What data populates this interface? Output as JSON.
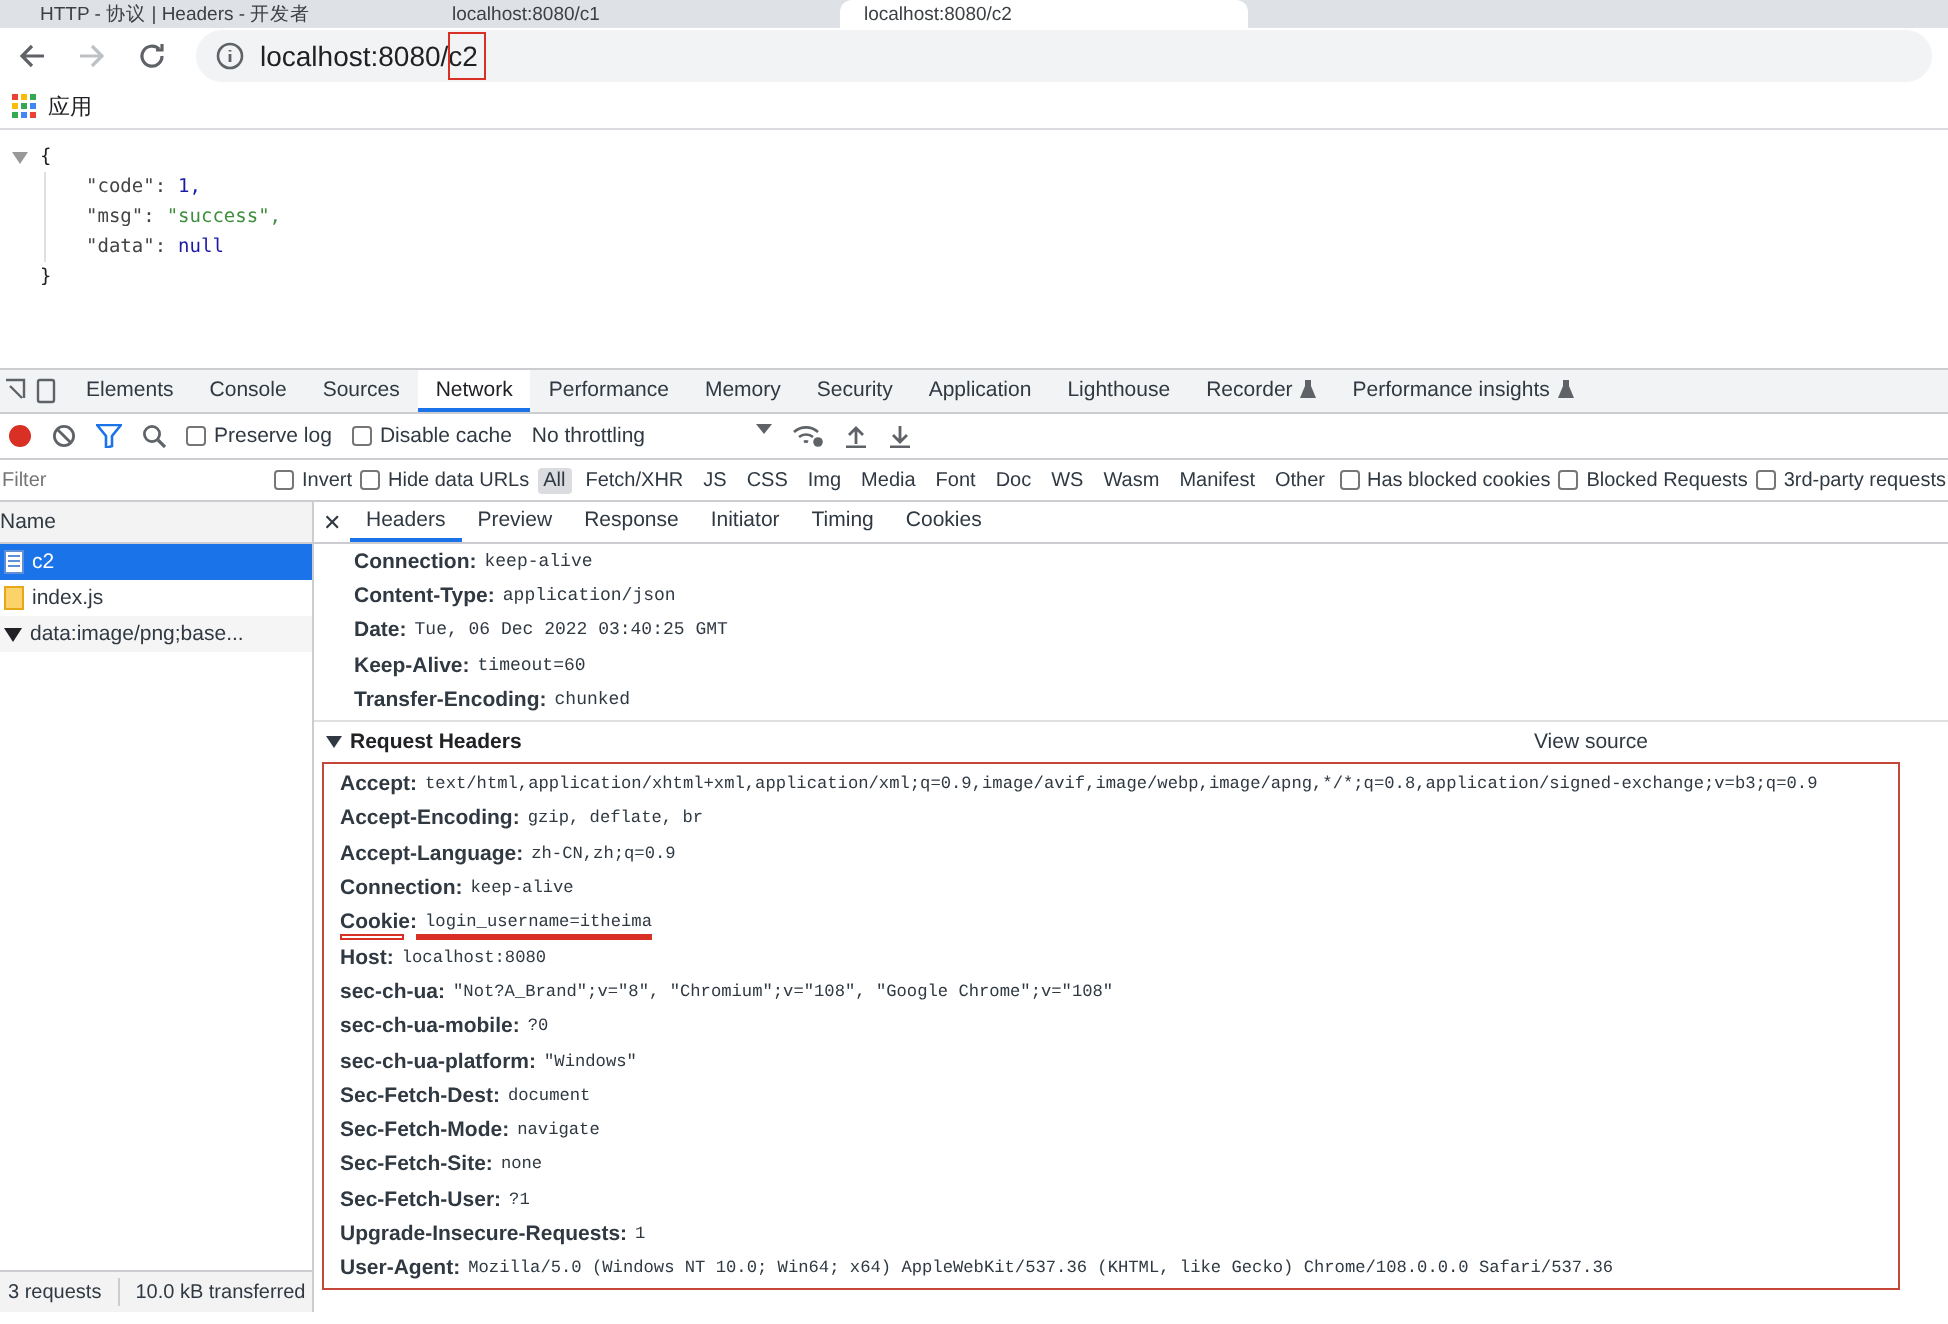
{
  "browser_tabs": [
    {
      "title": "HTTP - 协议 | Headers - 开发者",
      "selected": false
    },
    {
      "title": "localhost:8080/c1",
      "selected": false
    },
    {
      "title": "localhost:8080/c2",
      "selected": true
    }
  ],
  "address_bar": {
    "url": "localhost:8080/c2"
  },
  "bookmarks": [
    {
      "label": "应用"
    }
  ],
  "json_view": {
    "open": "{",
    "close": "}",
    "entries": [
      {
        "key": "\"code\":",
        "value": "1,",
        "kind": "number"
      },
      {
        "key": "\"msg\":",
        "value": "\"success\",",
        "kind": "string"
      },
      {
        "key": "\"data\":",
        "value": "null",
        "kind": "null"
      }
    ]
  },
  "devtools": {
    "tabs": [
      {
        "label": "Elements",
        "selected": false
      },
      {
        "label": "Console",
        "selected": false
      },
      {
        "label": "Sources",
        "selected": false
      },
      {
        "label": "Network",
        "selected": true
      },
      {
        "label": "Performance",
        "selected": false
      },
      {
        "label": "Memory",
        "selected": false
      },
      {
        "label": "Security",
        "selected": false
      },
      {
        "label": "Application",
        "selected": false
      },
      {
        "label": "Lighthouse",
        "selected": false
      },
      {
        "label": "Recorder",
        "selected": false,
        "experimental": true
      },
      {
        "label": "Performance insights",
        "selected": false,
        "experimental": true
      }
    ],
    "toolbar": {
      "options": [
        {
          "label": "Preserve log",
          "checked": false
        },
        {
          "label": "Disable cache",
          "checked": false
        }
      ],
      "throttling": "No throttling"
    },
    "filter": {
      "placeholder": "Filter",
      "options": [
        {
          "label": "Invert",
          "checked": false
        },
        {
          "label": "Hide data URLs",
          "checked": false
        }
      ],
      "types": [
        {
          "label": "All",
          "selected": true
        },
        {
          "label": "Fetch/XHR",
          "selected": false
        },
        {
          "label": "JS",
          "selected": false
        },
        {
          "label": "CSS",
          "selected": false
        },
        {
          "label": "Img",
          "selected": false
        },
        {
          "label": "Media",
          "selected": false
        },
        {
          "label": "Font",
          "selected": false
        },
        {
          "label": "Doc",
          "selected": false
        },
        {
          "label": "WS",
          "selected": false
        },
        {
          "label": "Wasm",
          "selected": false
        },
        {
          "label": "Manifest",
          "selected": false
        },
        {
          "label": "Other",
          "selected": false
        }
      ],
      "extra_options": [
        {
          "label": "Has blocked cookies",
          "checked": false
        },
        {
          "label": "Blocked Requests",
          "checked": false
        },
        {
          "label": "3rd-party requests",
          "checked": false
        }
      ]
    },
    "requests": {
      "column": "Name",
      "rows": [
        {
          "name": "c2",
          "kind": "document",
          "selected": true
        },
        {
          "name": "index.js",
          "kind": "script",
          "selected": false
        },
        {
          "name": "data:image/png;base...",
          "kind": "image",
          "selected": false
        }
      ]
    },
    "detail_close": "✕",
    "detail_tabs": [
      {
        "label": "Headers",
        "selected": true
      },
      {
        "label": "Preview",
        "selected": false
      },
      {
        "label": "Response",
        "selected": false
      },
      {
        "label": "Initiator",
        "selected": false
      },
      {
        "label": "Timing",
        "selected": false
      },
      {
        "label": "Cookies",
        "selected": false
      }
    ],
    "response_headers": [
      {
        "name": "Connection:",
        "value": "keep-alive"
      },
      {
        "name": "Content-Type:",
        "value": "application/json"
      },
      {
        "name": "Date:",
        "value": "Tue, 06 Dec 2022 03:40:25 GMT"
      },
      {
        "name": "Keep-Alive:",
        "value": "timeout=60"
      },
      {
        "name": "Transfer-Encoding:",
        "value": "chunked"
      }
    ],
    "request_headers": {
      "title": "Request Headers",
      "expanded": true,
      "view_source": "View source",
      "rows": [
        {
          "name": "Accept:",
          "value": "text/html,application/xhtml+xml,application/xml;q=0.9,image/avif,image/webp,image/apng,*/*;q=0.8,application/signed-exchange;v=b3;q=0.9",
          "marked": false
        },
        {
          "name": "Accept-Encoding:",
          "value": "gzip, deflate, br",
          "marked": false
        },
        {
          "name": "Accept-Language:",
          "value": "zh-CN,zh;q=0.9",
          "marked": false
        },
        {
          "name": "Connection:",
          "value": "keep-alive",
          "marked": false
        },
        {
          "name": "Cookie:",
          "value": "login_username=itheima",
          "marked": true
        },
        {
          "name": "Host:",
          "value": "localhost:8080",
          "marked": false
        },
        {
          "name": "sec-ch-ua:",
          "value": "\"Not?A_Brand\";v=\"8\", \"Chromium\";v=\"108\", \"Google Chrome\";v=\"108\"",
          "marked": false
        },
        {
          "name": "sec-ch-ua-mobile:",
          "value": "?0",
          "marked": false
        },
        {
          "name": "sec-ch-ua-platform:",
          "value": "\"Windows\"",
          "marked": false
        },
        {
          "name": "Sec-Fetch-Dest:",
          "value": "document",
          "marked": false
        },
        {
          "name": "Sec-Fetch-Mode:",
          "value": "navigate",
          "marked": false
        },
        {
          "name": "Sec-Fetch-Site:",
          "value": "none",
          "marked": false
        },
        {
          "name": "Sec-Fetch-User:",
          "value": "?1",
          "marked": false
        },
        {
          "name": "Upgrade-Insecure-Requests:",
          "value": "1",
          "marked": false
        },
        {
          "name": "User-Agent:",
          "value": "Mozilla/5.0 (Windows NT 10.0; Win64; x64) AppleWebKit/537.36 (KHTML, like Gecko) Chrome/108.0.0.0 Safari/537.36",
          "marked": false
        }
      ]
    },
    "status_bar": [
      "3 requests",
      "10.0 kB transferred"
    ]
  }
}
